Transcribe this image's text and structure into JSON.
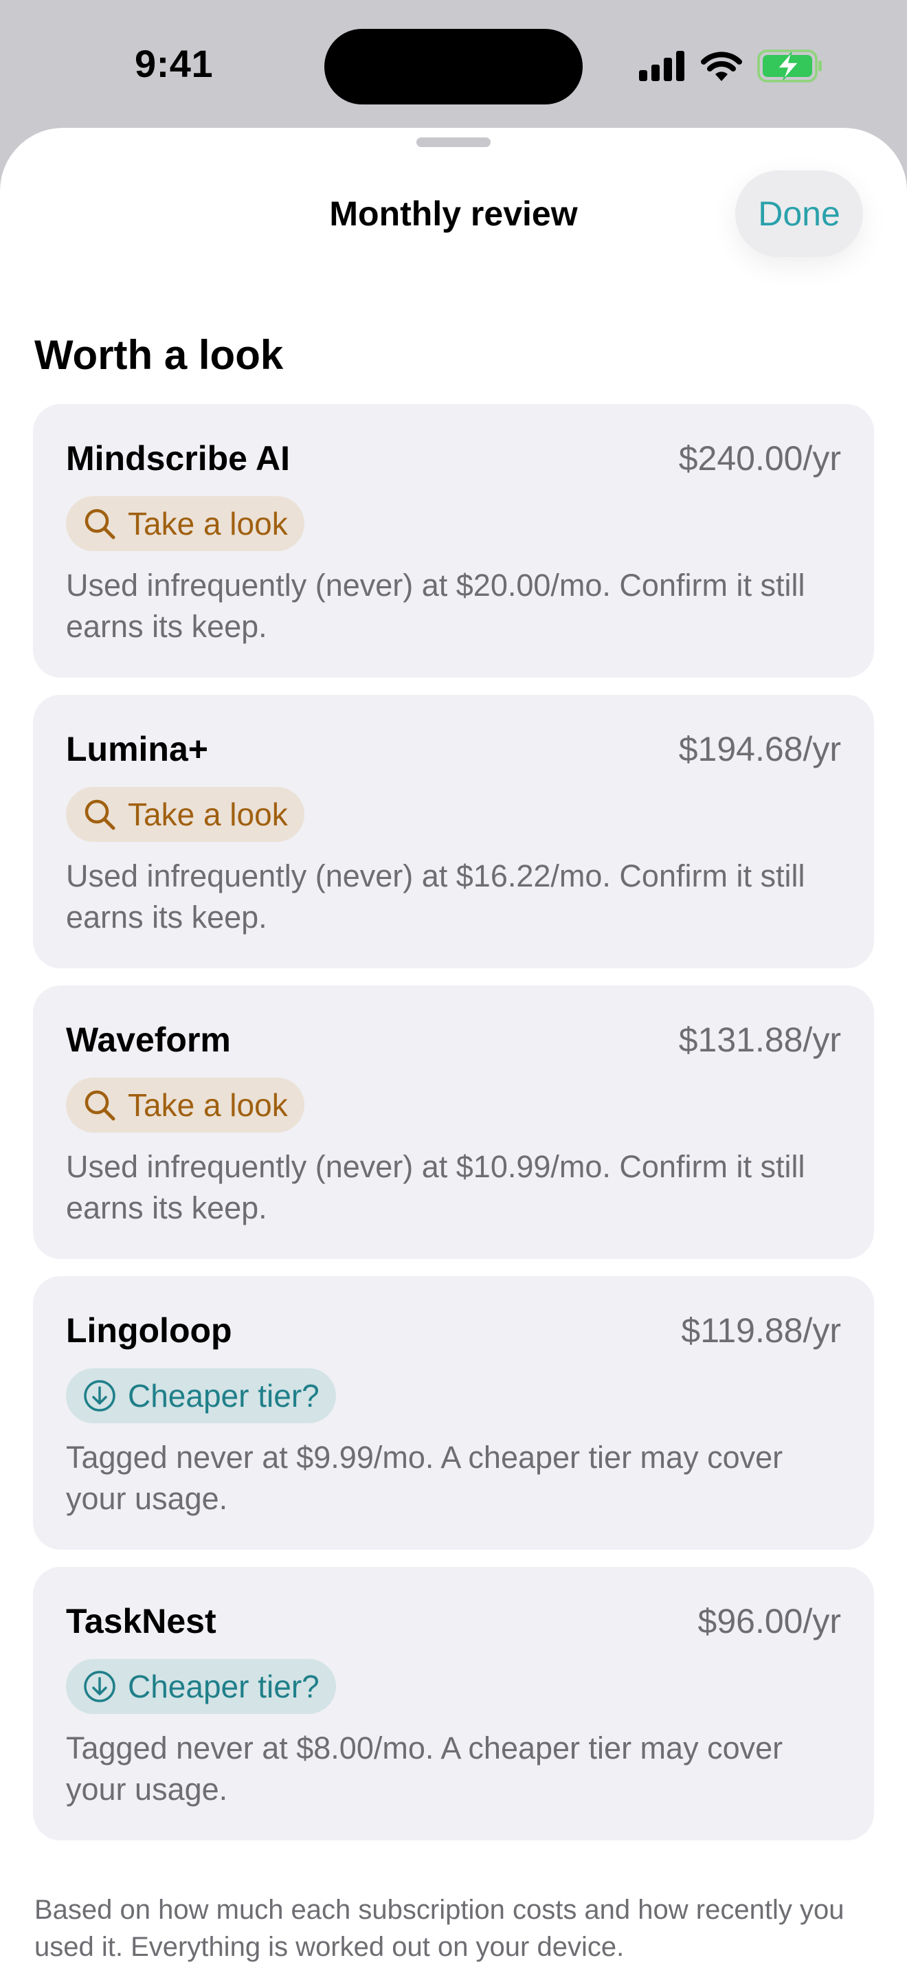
{
  "status_bar": {
    "time": "9:41",
    "icons": [
      "cellular-signal-icon",
      "wifi-icon",
      "battery-charging-icon"
    ]
  },
  "sheet": {
    "title": "Monthly review",
    "done_label": "Done"
  },
  "section": {
    "title": "Worth a look"
  },
  "colors": {
    "accent": "#2aa1ab",
    "look_badge_bg": "#ebe1d6",
    "look_badge_fg": "#a06010",
    "cheaper_badge_bg": "#d3e3e6",
    "cheaper_badge_fg": "#1f7f89",
    "card_bg": "#f0f0f5",
    "secondary_text": "#6d6d72"
  },
  "items": [
    {
      "name": "Mindscribe AI",
      "price": "$240.00/yr",
      "badge": "Take a look",
      "badge_icon": "magnifying-glass-icon",
      "description": "Used infrequently (never) at $20.00/mo. Confirm it still earns its keep."
    },
    {
      "name": "Lumina+",
      "price": "$194.68/yr",
      "badge": "Take a look",
      "badge_icon": "magnifying-glass-icon",
      "description": "Used infrequently (never) at $16.22/mo. Confirm it still earns its keep."
    },
    {
      "name": "Waveform",
      "price": "$131.88/yr",
      "badge": "Take a look",
      "badge_icon": "magnifying-glass-icon",
      "description": "Used infrequently (never) at $10.99/mo. Confirm it still earns its keep."
    },
    {
      "name": "Lingoloop",
      "price": "$119.88/yr",
      "badge": "Cheaper tier?",
      "badge_icon": "arrow-down-circle-icon",
      "description": "Tagged never at $9.99/mo. A cheaper tier may cover your usage."
    },
    {
      "name": "TaskNest",
      "price": "$96.00/yr",
      "badge": "Cheaper tier?",
      "badge_icon": "arrow-down-circle-icon",
      "description": "Tagged never at $8.00/mo. A cheaper tier may cover your usage."
    }
  ],
  "footnote": "Based on how much each subscription costs and how recently you used it. Everything is worked out on your device."
}
